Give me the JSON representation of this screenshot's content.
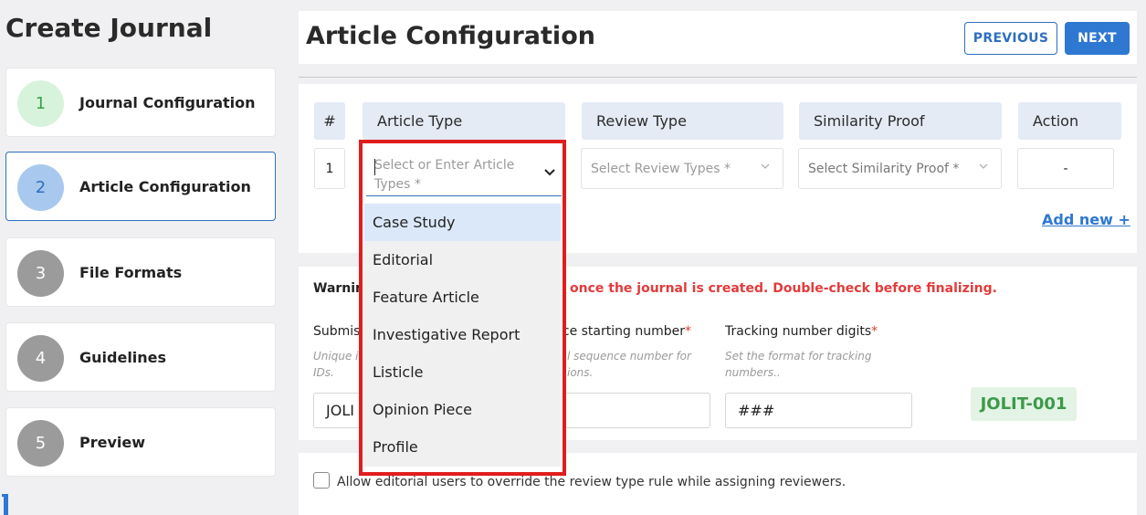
{
  "sidebar": {
    "title": "Create Journal",
    "steps": [
      {
        "number": "1",
        "label": "Journal Configuration",
        "state": "completed"
      },
      {
        "number": "2",
        "label": "Article Configuration",
        "state": "active"
      },
      {
        "number": "3",
        "label": "File Formats",
        "state": "pending"
      },
      {
        "number": "4",
        "label": "Guidelines",
        "state": "pending"
      },
      {
        "number": "5",
        "label": "Preview",
        "state": "pending"
      }
    ]
  },
  "header": {
    "title": "Article Configuration",
    "previous_label": "PREVIOUS",
    "next_label": "NEXT"
  },
  "table": {
    "columns": [
      "#",
      "Article Type",
      "Review Type",
      "Similarity Proof",
      "Action"
    ],
    "rows": [
      {
        "index": "1",
        "article_type_placeholder": "Select or Enter Article Types *",
        "review_type_placeholder": "Select Review Types *",
        "similarity_placeholder": "Select Similarity Proof *",
        "action": "-"
      }
    ],
    "add_new_label": "Add new +"
  },
  "warning": {
    "prefix": "Warnin",
    "suffix": "once the journal is created. Double-check before finalizing."
  },
  "fields": {
    "submission_label": "Submis",
    "submission_hint_line1": "Unique i",
    "submission_hint_line2": "IDs.",
    "submission_value": "JOLI",
    "sequence_label": "nce starting number",
    "sequence_hint_line1": "l sequence number for",
    "sequence_hint_line2": "ions.",
    "digits_label": "Tracking number digits",
    "digits_hint_line1": "Set the format for tracking",
    "digits_hint_line2": "numbers..",
    "digits_value": "###",
    "preview_id": "JOLIT-001"
  },
  "override": {
    "label": "Allow editorial users to override the review type rule while assigning reviewers.",
    "checked": false
  },
  "dropdown": {
    "placeholder": "Select or Enter Article Types *",
    "options": [
      "Case Study",
      "Editorial",
      "Feature Article",
      "Investigative Report",
      "Listicle",
      "Opinion Piece",
      "Profile"
    ],
    "highlighted": "Case Study"
  },
  "colors": {
    "accent": "#2e78d2",
    "highlight_border": "#e11d1d",
    "warning": "#e23b3b",
    "success_bg": "#e3f3e5",
    "success_text": "#3c9a4a",
    "step_done_bg": "#d8f3dc",
    "step_active_bg": "#a9c8ee",
    "step_pending_bg": "#9b9b9b"
  }
}
